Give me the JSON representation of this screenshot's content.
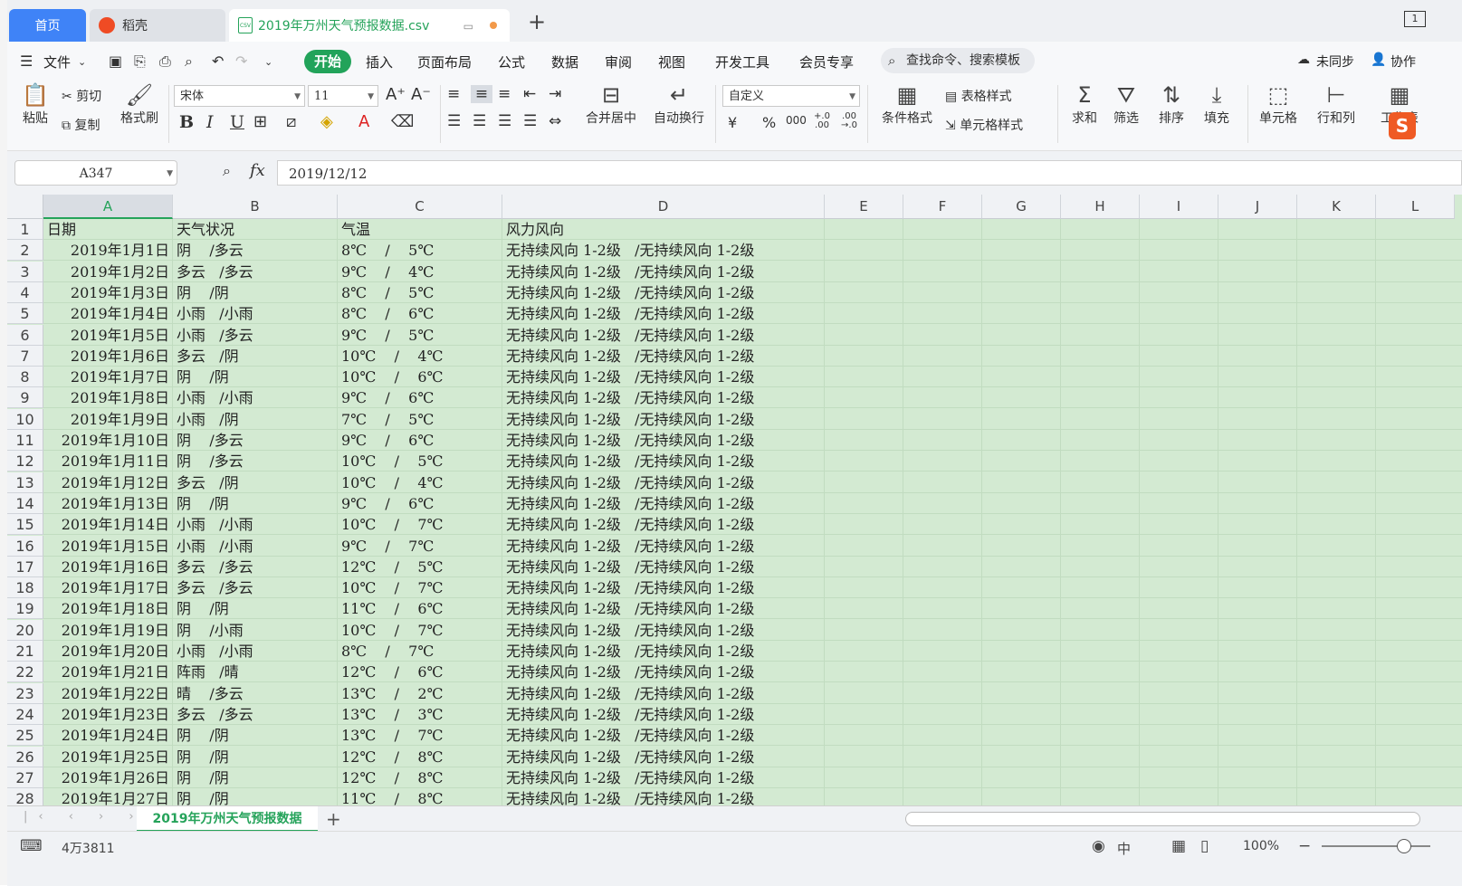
{
  "tabs": {
    "home": "首页",
    "shell": "稻壳",
    "file": "2019年万州天气预报数据.csv",
    "csv_badge": "CSV",
    "window_count": "1"
  },
  "menubar": {
    "file_menu": "文件",
    "items": [
      "开始",
      "插入",
      "页面布局",
      "公式",
      "数据",
      "审阅",
      "视图",
      "开发工具",
      "会员专享"
    ],
    "search": "查找命令、搜索模板",
    "sync": "未同步",
    "collab": "协作"
  },
  "ribbon": {
    "paste": "粘贴",
    "cut": "剪切",
    "copy": "复制",
    "format_painter": "格式刷",
    "font_name": "宋体",
    "font_size": "11",
    "merge": "合并居中",
    "wrap": "自动换行",
    "number_format": "自定义",
    "cond_format": "条件格式",
    "table_style": "表格样式",
    "cell_style": "单元格样式",
    "sum": "求和",
    "filter": "筛选",
    "sort": "排序",
    "fill": "填充",
    "cell": "单元格",
    "rowcol": "行和列",
    "worksheet": "工作表",
    "bold": "B",
    "italic": "I",
    "underline": "U",
    "currency": "¥",
    "percent": "%",
    "thousands": "000",
    "inc_decimal": "+.0 .00",
    "dec_decimal": ".00 →.0"
  },
  "formula": {
    "name_box": "A347",
    "fx": "fx",
    "value": "2019/12/12"
  },
  "columns": [
    "A",
    "B",
    "C",
    "D",
    "E",
    "F",
    "G",
    "H",
    "I",
    "J",
    "K",
    "L"
  ],
  "selected_column": "A",
  "rows": [
    {
      "n": "1",
      "a": "日期",
      "b": "天气状况",
      "c": "气温",
      "d": "风力风向"
    },
    {
      "n": "2",
      "a": "2019年1月1日",
      "b": "阴    /多云",
      "c": "8℃    /    5℃",
      "d": "无持续风向 1-2级   /无持续风向 1-2级"
    },
    {
      "n": "3",
      "a": "2019年1月2日",
      "b": "多云   /多云",
      "c": "9℃    /    4℃",
      "d": "无持续风向 1-2级   /无持续风向 1-2级"
    },
    {
      "n": "4",
      "a": "2019年1月3日",
      "b": "阴    /阴",
      "c": "8℃    /    5℃",
      "d": "无持续风向 1-2级   /无持续风向 1-2级"
    },
    {
      "n": "5",
      "a": "2019年1月4日",
      "b": "小雨   /小雨",
      "c": "8℃    /    6℃",
      "d": "无持续风向 1-2级   /无持续风向 1-2级"
    },
    {
      "n": "6",
      "a": "2019年1月5日",
      "b": "小雨   /多云",
      "c": "9℃    /    5℃",
      "d": "无持续风向 1-2级   /无持续风向 1-2级"
    },
    {
      "n": "7",
      "a": "2019年1月6日",
      "b": "多云   /阴",
      "c": "10℃    /    4℃",
      "d": "无持续风向 1-2级   /无持续风向 1-2级"
    },
    {
      "n": "8",
      "a": "2019年1月7日",
      "b": "阴    /阴",
      "c": "10℃    /    6℃",
      "d": "无持续风向 1-2级   /无持续风向 1-2级"
    },
    {
      "n": "9",
      "a": "2019年1月8日",
      "b": "小雨   /小雨",
      "c": "9℃    /    6℃",
      "d": "无持续风向 1-2级   /无持续风向 1-2级"
    },
    {
      "n": "10",
      "a": "2019年1月9日",
      "b": "小雨   /阴",
      "c": "7℃    /    5℃",
      "d": "无持续风向 1-2级   /无持续风向 1-2级"
    },
    {
      "n": "11",
      "a": "2019年1月10日",
      "b": "阴    /多云",
      "c": "9℃    /    6℃",
      "d": "无持续风向 1-2级   /无持续风向 1-2级"
    },
    {
      "n": "12",
      "a": "2019年1月11日",
      "b": "阴    /多云",
      "c": "10℃    /    5℃",
      "d": "无持续风向 1-2级   /无持续风向 1-2级"
    },
    {
      "n": "13",
      "a": "2019年1月12日",
      "b": "多云   /阴",
      "c": "10℃    /    4℃",
      "d": "无持续风向 1-2级   /无持续风向 1-2级"
    },
    {
      "n": "14",
      "a": "2019年1月13日",
      "b": "阴    /阴",
      "c": "9℃    /    6℃",
      "d": "无持续风向 1-2级   /无持续风向 1-2级"
    },
    {
      "n": "15",
      "a": "2019年1月14日",
      "b": "小雨   /小雨",
      "c": "10℃    /    7℃",
      "d": "无持续风向 1-2级   /无持续风向 1-2级"
    },
    {
      "n": "16",
      "a": "2019年1月15日",
      "b": "小雨   /小雨",
      "c": "9℃    /    7℃",
      "d": "无持续风向 1-2级   /无持续风向 1-2级"
    },
    {
      "n": "17",
      "a": "2019年1月16日",
      "b": "多云   /多云",
      "c": "12℃    /    5℃",
      "d": "无持续风向 1-2级   /无持续风向 1-2级"
    },
    {
      "n": "18",
      "a": "2019年1月17日",
      "b": "多云   /多云",
      "c": "10℃    /    7℃",
      "d": "无持续风向 1-2级   /无持续风向 1-2级"
    },
    {
      "n": "19",
      "a": "2019年1月18日",
      "b": "阴    /阴",
      "c": "11℃    /    6℃",
      "d": "无持续风向 1-2级   /无持续风向 1-2级"
    },
    {
      "n": "20",
      "a": "2019年1月19日",
      "b": "阴    /小雨",
      "c": "10℃    /    7℃",
      "d": "无持续风向 1-2级   /无持续风向 1-2级"
    },
    {
      "n": "21",
      "a": "2019年1月20日",
      "b": "小雨   /小雨",
      "c": "8℃    /    7℃",
      "d": "无持续风向 1-2级   /无持续风向 1-2级"
    },
    {
      "n": "22",
      "a": "2019年1月21日",
      "b": "阵雨   /晴",
      "c": "12℃    /    6℃",
      "d": "无持续风向 1-2级   /无持续风向 1-2级"
    },
    {
      "n": "23",
      "a": "2019年1月22日",
      "b": "晴    /多云",
      "c": "13℃    /    2℃",
      "d": "无持续风向 1-2级   /无持续风向 1-2级"
    },
    {
      "n": "24",
      "a": "2019年1月23日",
      "b": "多云   /多云",
      "c": "13℃    /    3℃",
      "d": "无持续风向 1-2级   /无持续风向 1-2级"
    },
    {
      "n": "25",
      "a": "2019年1月24日",
      "b": "阴    /阴",
      "c": "13℃    /    7℃",
      "d": "无持续风向 1-2级   /无持续风向 1-2级"
    },
    {
      "n": "26",
      "a": "2019年1月25日",
      "b": "阴    /阴",
      "c": "12℃    /    8℃",
      "d": "无持续风向 1-2级   /无持续风向 1-2级"
    },
    {
      "n": "27",
      "a": "2019年1月26日",
      "b": "阴    /阴",
      "c": "12℃    /    8℃",
      "d": "无持续风向 1-2级   /无持续风向 1-2级"
    },
    {
      "n": "28",
      "a": "2019年1月27日",
      "b": "阴    /阴",
      "c": "11℃    /    8℃",
      "d": "无持续风向 1-2级   /无持续风向 1-2级"
    }
  ],
  "sheet": {
    "tab": "2019年万州天气预报数据",
    "add": "+"
  },
  "status": {
    "count": "4万3811",
    "zoom": "100%",
    "ime": "中"
  },
  "colors": {
    "accent_green": "#25a35a",
    "home_tab_blue": "#3f83f7",
    "selection_fill": "#d3ead2"
  }
}
